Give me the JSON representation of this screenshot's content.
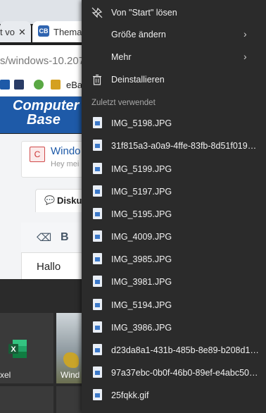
{
  "browser": {
    "tab_partial": "t vo",
    "tab_title": "Thema",
    "tab_close": "✕",
    "address": "s/windows-10.207/",
    "bookmark_ebay": "eBay"
  },
  "site": {
    "logo_top": "Computer",
    "logo_bottom": "Base",
    "card_avatar": "C",
    "card_title": "Windo",
    "card_sub": "Hey mei",
    "tab_label": "Disku",
    "editor_bold": "B",
    "editor_text": "Hallo"
  },
  "taskbar": {
    "excel_label": "xel",
    "photos_label": "Wind"
  },
  "menu": {
    "items": [
      {
        "label": "Von \"Start\" lösen",
        "icon": "unpin-icon",
        "glyph": "✂",
        "submenu": false
      },
      {
        "label": "Größe ändern",
        "icon": "resize-icon",
        "glyph": "",
        "submenu": true
      },
      {
        "label": "Mehr",
        "icon": "more-icon",
        "glyph": "",
        "submenu": true
      },
      {
        "label": "Deinstallieren",
        "icon": "trash-icon",
        "glyph": "🗑",
        "submenu": false
      }
    ],
    "chevron": "›",
    "section_title": "Zuletzt verwendet",
    "recent": [
      "IMG_5198.JPG",
      "31f815a3-a0a9-4ffe-83fb-8d51f0193e...",
      "IMG_5199.JPG",
      "IMG_5197.JPG",
      "IMG_5195.JPG",
      "IMG_4009.JPG",
      "IMG_3985.JPG",
      "IMG_3981.JPG",
      "IMG_5194.JPG",
      "IMG_3986.JPG",
      "d23da8a1-431b-485b-8e89-b208d183...",
      "97a37ebc-0b0f-46b0-89ef-e4abc5076...",
      "25fqkk.gif"
    ]
  }
}
